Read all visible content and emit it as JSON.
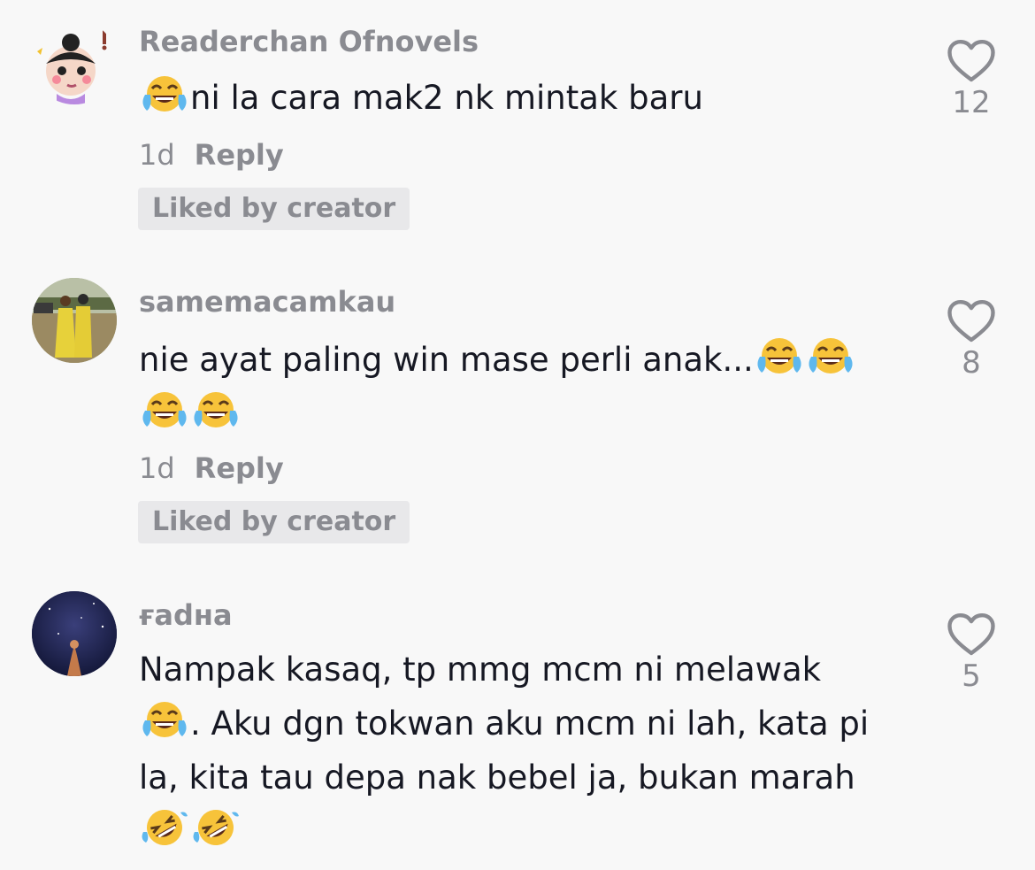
{
  "comments": [
    {
      "username": "Readerchan Ofnovels",
      "text_parts": [
        "ni la cara mak2 nk mintak baru"
      ],
      "time": "1d",
      "reply_label": "Reply",
      "badge": "Liked by creator",
      "likes": "12"
    },
    {
      "username": "samemacamkau",
      "text_parts": [
        "nie ayat paling win mase perli anak..."
      ],
      "time": "1d",
      "reply_label": "Reply",
      "badge": "Liked by creator",
      "likes": "8"
    },
    {
      "username": "ғadнa",
      "text_parts": [
        "Nampak kasaq, tp mmg mcm ni melawak",
        ". Aku dgn tokwan aku mcm ni lah, kata pi la, kita tau depa nak bebel ja, bukan marah "
      ],
      "likes": "5"
    }
  ],
  "icons": {
    "like": "heart-outline-icon",
    "tears_of_joy": "face-with-tears-of-joy-emoji",
    "rolling_laughing": "rolling-on-floor-laughing-emoji"
  },
  "colors": {
    "background": "#f8f8f8",
    "text": "#161823",
    "muted": "#8a8b91",
    "badge_bg": "#e8e8ea"
  }
}
